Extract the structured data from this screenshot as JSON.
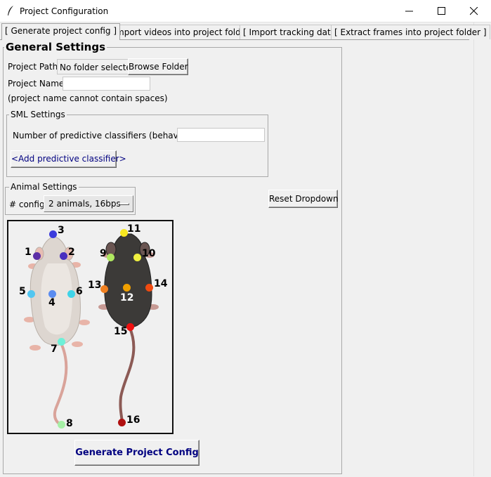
{
  "window": {
    "title": "Project Configuration",
    "minimize_label": "minimize",
    "maximize_label": "maximize",
    "close_label": "close"
  },
  "tabs": [
    {
      "label": "[ Generate project config ]"
    },
    {
      "label": "[ Import videos into project folder ]"
    },
    {
      "label": "[ Import tracking data ]"
    },
    {
      "label": "[ Extract frames into project folder ]"
    }
  ],
  "general": {
    "heading": "General Settings",
    "project_path_label": "Project Path:",
    "project_path_value": "No folder selected",
    "browse_button": "Browse Folder",
    "project_name_label": "Project Name:",
    "project_name_value": "",
    "project_name_hint": "(project name cannot contain spaces)"
  },
  "sml": {
    "heading": "SML Settings",
    "num_classifiers_label": "Number of predictive classifiers (behaviors):",
    "num_classifiers_value": "",
    "add_button": "<Add predictive classifier>"
  },
  "animal": {
    "heading": "Animal Settings",
    "config_label": "# config",
    "config_value": "2 animals, 16bps",
    "reset_button": "Reset Dropdown"
  },
  "bodyparts": {
    "white_mouse": [
      "1",
      "2",
      "3",
      "4",
      "5",
      "6",
      "7",
      "8"
    ],
    "black_mouse": [
      "9",
      "10",
      "11",
      "12",
      "13",
      "14",
      "15",
      "16"
    ],
    "colors": {
      "1": "#5b2ea6",
      "2": "#4b2fbf",
      "3": "#3c3cdc",
      "4": "#5a8cf0",
      "5": "#52c6f0",
      "6": "#3fd3e8",
      "7": "#6ef0d8",
      "8": "#a6f0a6",
      "9": "#b0e860",
      "10": "#f0f040",
      "11": "#f8e820",
      "12": "#f0a000",
      "13": "#f08020",
      "14": "#f04a10",
      "15": "#f01010",
      "16": "#b01010"
    }
  },
  "generate_button": "Generate Project Config"
}
